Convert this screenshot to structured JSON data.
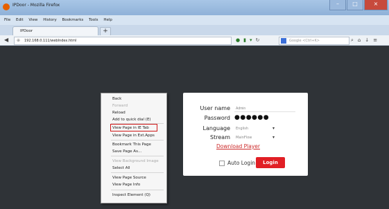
{
  "window": {
    "title": "IPDoor - Mozilla Firefox"
  },
  "menubar": [
    "File",
    "Edit",
    "View",
    "History",
    "Bookmarks",
    "Tools",
    "Help"
  ],
  "tab": {
    "label": "IPDoor",
    "new_tab": "+"
  },
  "navbar": {
    "back": "◀",
    "url": "192.168.0.111/webIndex.html",
    "search_placeholder": "Google <Ctrl+K>"
  },
  "context_menu": {
    "items": [
      {
        "label": "Back",
        "disabled": false
      },
      {
        "label": "Forward",
        "disabled": true
      },
      {
        "label": "Reload",
        "disabled": false
      },
      {
        "label": "Add to quick dial (E)",
        "disabled": false
      },
      {
        "label": "View Page in IE Tab",
        "disabled": false,
        "highlighted": true
      },
      {
        "label": "View Page in Ext.Apps",
        "disabled": false
      },
      {
        "label": "Bookmark This Page",
        "disabled": false
      },
      {
        "label": "Save Page As...",
        "disabled": false
      },
      {
        "label": "View Background Image",
        "disabled": true
      },
      {
        "label": "Select All",
        "disabled": false
      },
      {
        "label": "View Page Source",
        "disabled": false
      },
      {
        "label": "View Page Info",
        "disabled": false
      },
      {
        "label": "Inspect Element (Q)",
        "disabled": false
      }
    ]
  },
  "login": {
    "username_label": "User name",
    "username_value": "Admin",
    "password_label": "Password",
    "password_value": "●●●●●●",
    "language_label": "Language",
    "language_value": "English",
    "stream_label": "Stream",
    "stream_value": "MainFlow",
    "download_link": "Download Player",
    "auto_login_label": "Auto Login",
    "login_button": "Login"
  },
  "colors": {
    "accent_red": "#e11f25",
    "page_bg": "#2f3337",
    "link_red": "#cc2a2a"
  }
}
